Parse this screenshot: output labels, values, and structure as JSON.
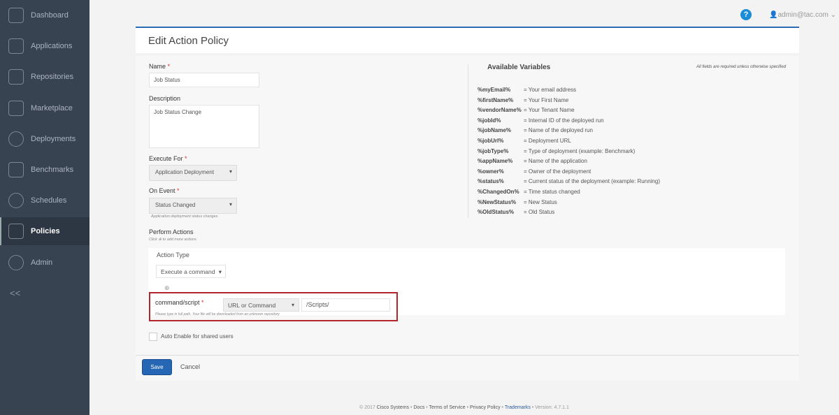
{
  "sidebar": {
    "items": [
      {
        "label": "Dashboard"
      },
      {
        "label": "Applications"
      },
      {
        "label": "Repositories"
      },
      {
        "label": "Marketplace"
      },
      {
        "label": "Deployments"
      },
      {
        "label": "Benchmarks"
      },
      {
        "label": "Schedules"
      },
      {
        "label": "Policies"
      },
      {
        "label": "Admin"
      }
    ],
    "collapse": "<<"
  },
  "topbar": {
    "help": "?",
    "user": "admin@tac.com"
  },
  "page": {
    "title": "Edit Action Policy",
    "required_note": "All fields are required unless otherwise specified"
  },
  "form": {
    "name_label": "Name",
    "name_value": "Job Status",
    "description_label": "Description",
    "description_value": "Job Status Change",
    "execute_for_label": "Execute For",
    "execute_for_value": "Application Deployment",
    "on_event_label": "On Event",
    "on_event_value": "Status Changed",
    "on_event_hint": "Application deployment status changes.",
    "perform_actions_label": "Perform Actions",
    "perform_actions_hint": "Click ⊕ to add more actions",
    "action_type_label": "Action Type",
    "action_type_value": "Execute a command",
    "command_label": "command/script",
    "command_type_value": "URL or Command",
    "command_value": "/Scripts/",
    "command_hint": "Please type in full path. Your file will be downloaded from an unknown repository",
    "auto_enable_label": "Auto Enable for shared users",
    "save": "Save",
    "cancel": "Cancel"
  },
  "variables": {
    "title": "Available Variables",
    "items": [
      {
        "name": "%myEmail%",
        "desc": "= Your email address"
      },
      {
        "name": "%firstName%",
        "desc": "= Your First Name"
      },
      {
        "name": "%vendorName%",
        "desc": "= Your Tenant Name"
      },
      {
        "name": "%jobId%",
        "desc": "= Internal ID of the deployed run"
      },
      {
        "name": "%jobName%",
        "desc": "= Name of the deployed run"
      },
      {
        "name": "%jobUrl%",
        "desc": "= Deployment URL"
      },
      {
        "name": "%jobType%",
        "desc": "= Type of deployment (example: Benchmark)"
      },
      {
        "name": "%appName%",
        "desc": "= Name of the application"
      },
      {
        "name": "%owner%",
        "desc": "= Owner of the deployment"
      },
      {
        "name": "%status%",
        "desc": "= Current status of the deployment (example: Running)"
      },
      {
        "name": "%ChangedOn%",
        "desc": "= Time status changed"
      },
      {
        "name": "%NewStatus%",
        "desc": "= New Status"
      },
      {
        "name": "%OldStatus%",
        "desc": "= Old Status"
      }
    ]
  },
  "footer": {
    "copyright": "© 2017",
    "company": "Cisco Systems",
    "docs": "Docs",
    "terms": "Terms of Service",
    "privacy": "Privacy Policy",
    "trademarks": "Trademarks",
    "version": "Version: 4.7.1.1"
  }
}
